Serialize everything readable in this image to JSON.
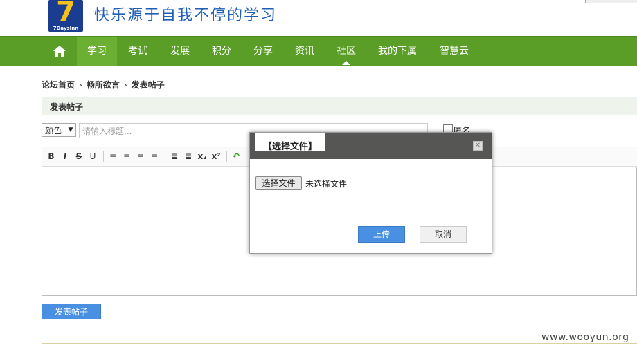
{
  "header": {
    "logo_numeral": "7",
    "logo_brand": "7DaysInn",
    "slogan": "快乐源于自我不停的学习"
  },
  "nav": {
    "items": [
      "学习",
      "考试",
      "发展",
      "积分",
      "分享",
      "资讯",
      "社区",
      "我的下属",
      "智慧云"
    ],
    "active": "学习",
    "current": "社区",
    "home_icon": "home-icon"
  },
  "breadcrumb": [
    "论坛首页",
    "畅所欲言",
    "发表帖子"
  ],
  "section_title": "发表帖子",
  "form": {
    "color_select": "颜色",
    "title_placeholder": "请输入标题...",
    "anonymous_label": "匿名"
  },
  "toolbar": {
    "buttons": [
      "B",
      "I",
      "S",
      "U",
      "≡",
      "≡",
      "≡",
      "≡",
      "≣",
      "≣",
      "x₂",
      "x²",
      "↶"
    ]
  },
  "submit_label": "发表帖子",
  "modal": {
    "title": "【选择文件】",
    "choose_label": "选择文件",
    "no_file_text": "未选择文件",
    "upload_label": "上传",
    "cancel_label": "取消"
  },
  "watermark": "www.wooyun.org",
  "colors": {
    "nav_green": "#5a9e27",
    "nav_active": "#6bb033",
    "primary_blue": "#4a90e2",
    "modal_header": "#565654"
  }
}
